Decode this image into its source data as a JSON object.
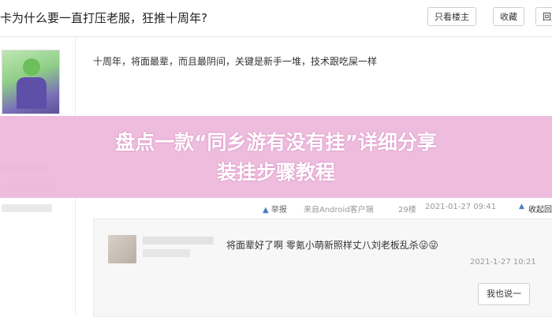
{
  "header": {
    "thread_title": "卡为什么要一直打压老服，狂推十周年?",
    "only_op_label": "只看楼主",
    "favorite_label": "收藏",
    "reply_label": "回复"
  },
  "post": {
    "text": "十周年，将面最辈，而且最阴间，关键是新手一堆，技术跟吃屎一样",
    "report_label": "举报",
    "source_label": "来自Android客户端",
    "floor_label": "29楼",
    "timestamp": "2021-01-27 09:41",
    "reply_toggle_label": "收起回"
  },
  "comment": {
    "text": "将面辈好了啊 零氪小萌新照样丈八刘老板乱杀",
    "emoji": "😜😜",
    "timestamp": "2021-1-27 10:21",
    "reply_button_label": "我也说一"
  },
  "banner": {
    "line1": "盘点一款“同乡游有没有挂”详细分享",
    "line2": "装挂步骤教程"
  }
}
